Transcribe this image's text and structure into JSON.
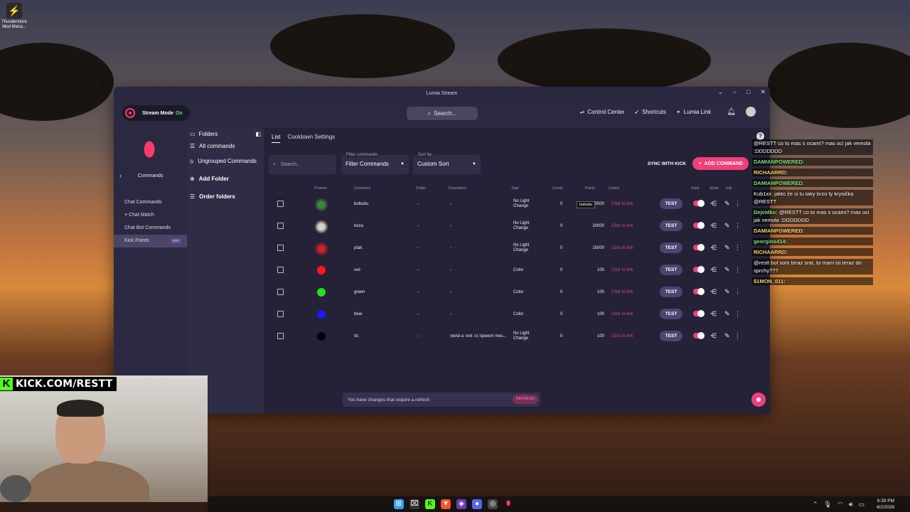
{
  "desktop": {
    "icon_label": "Thunderstore Mod Mana..."
  },
  "window": {
    "title": "Lumia Stream"
  },
  "topbar": {
    "stream_mode_label": "Stream Mode",
    "stream_mode_state": "On",
    "search_placeholder": "Search...",
    "nav": [
      "Control Center",
      "Shortcuts",
      "Lumia Link"
    ]
  },
  "sidebar": {
    "section": "Commands",
    "items": [
      "Chat Commands",
      "Chat Match",
      "Chat Bot Commands",
      "Kick Points"
    ],
    "badge": "new"
  },
  "folders": {
    "header": "Folders",
    "items": [
      "All commands",
      "Ungrouped Commands",
      "Add Folder",
      "Order folders"
    ]
  },
  "tabs": [
    "List",
    "Cooldown Settings"
  ],
  "controls": {
    "search_placeholder": "Search...",
    "filter_label": "Filter commands",
    "filter_value": "Filter Commands",
    "sort_label": "Sort by:",
    "sort_value": "Custom Sort",
    "sync_label": "SYNC WITH KICK",
    "add_label": "ADD COMMAND"
  },
  "table": {
    "headers": [
      "Preview",
      "Command",
      "Folder",
      "Description",
      "Type",
      "Levels",
      "Points",
      "Linked",
      "State",
      "Share",
      "Edit"
    ],
    "rows": [
      {
        "command": "bububu",
        "folder": "-",
        "description": "-",
        "type": "No Light Change",
        "levels": "0",
        "points": "20000",
        "linked": "Click to link",
        "test": "TEST",
        "preview": "image",
        "color": "#3a8a3a"
      },
      {
        "command": "koza",
        "folder": "-",
        "description": "-",
        "type": "No Light Change",
        "levels": "0",
        "points": "20000",
        "linked": "Click to link",
        "test": "TEST",
        "preview": "image",
        "color": "#d9d3c4"
      },
      {
        "command": "ptak",
        "folder": "-",
        "description": "-",
        "type": "No Light Change",
        "levels": "0",
        "points": "15000",
        "linked": "Click to link",
        "test": "TEST",
        "preview": "image",
        "color": "#c22"
      },
      {
        "command": "red",
        "folder": "-",
        "description": "-",
        "type": "Color",
        "levels": "0",
        "points": "100",
        "linked": "Click to link",
        "test": "TEST",
        "preview": "circle",
        "color": "#ff1a1a"
      },
      {
        "command": "green",
        "folder": "-",
        "description": "-",
        "type": "Color",
        "levels": "0",
        "points": "100",
        "linked": "Click to link",
        "test": "TEST",
        "preview": "circle",
        "color": "#22e022"
      },
      {
        "command": "blue",
        "folder": "-",
        "description": "-",
        "type": "Color",
        "levels": "0",
        "points": "100",
        "linked": "Click to link",
        "test": "TEST",
        "preview": "circle",
        "color": "#1a1aff"
      },
      {
        "command": "tts",
        "folder": "-",
        "description": "Send a Text To Speech mes...",
        "type": "No Light Change",
        "levels": "0",
        "points": "100",
        "linked": "Click to link",
        "test": "TEST",
        "preview": "circle",
        "color": "#000000"
      }
    ],
    "tooltip": "bububu"
  },
  "refresh": {
    "message": "You have changes that require a refresh",
    "button": "REFRESH"
  },
  "webcam": {
    "banner": "KICK.COM/RESTT"
  },
  "chat": [
    {
      "name": "",
      "text": "@RESTT co to mas s ocami? mas oci jak vemola :DDDDDDD"
    },
    {
      "name": "DAMIANPOWERED:",
      "text": ""
    },
    {
      "name": "RICHAARRD:",
      "text": ""
    },
    {
      "name": "DAMIANPOWERED:",
      "text": ""
    },
    {
      "name": "",
      "text": "Kub1xx: jakto že si tu taky brzo ty krysička @RESTT"
    },
    {
      "name": "Dejvidko:",
      "text": "@RESTT co to mas s ocami? mas oci jak vemola :DDDDDDD"
    },
    {
      "name": "DAMIANPOWERED:",
      "text": ""
    },
    {
      "name": "georgino414:",
      "text": ""
    },
    {
      "name": "RICHAARRD:",
      "text": ""
    },
    {
      "name": "",
      "text": "@restt bol som teraz srat, to mam ist teraz do sprchy???"
    },
    {
      "name": "$1MON_011:",
      "text": ""
    }
  ],
  "taskbar": {
    "time": "6:39 PM",
    "date": "4/2/2026"
  },
  "colors": {
    "accent": "#f23f79",
    "window_bg": "#252238",
    "sidebar_bg": "#2b2841"
  }
}
